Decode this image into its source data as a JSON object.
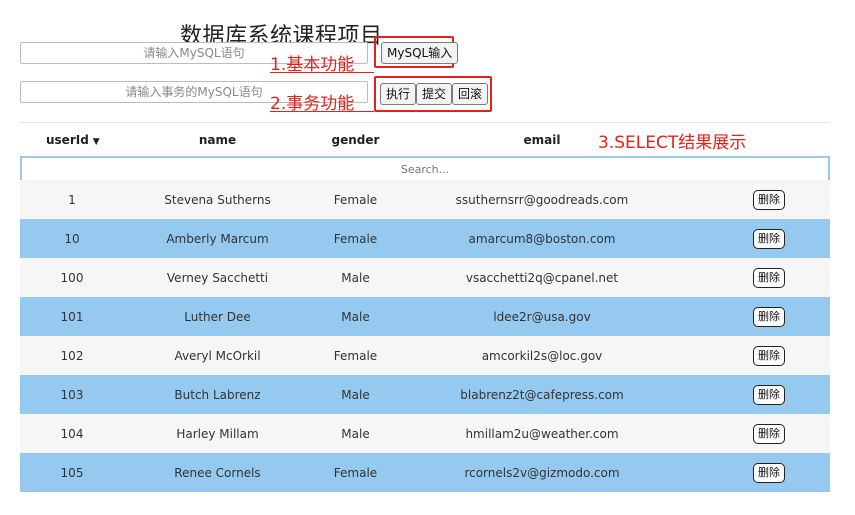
{
  "page": {
    "title": "数据库系统课程项目"
  },
  "sql_input": {
    "placeholder": "请输入MySQL语句"
  },
  "tx_input": {
    "placeholder": "请输入事务的MySQL语句"
  },
  "buttons": {
    "mysql": "MySQL输入",
    "exec": "执行",
    "commit": "提交",
    "rollback": "回滚"
  },
  "annotations": {
    "a1": "1.基本功能",
    "a2": "2.事务功能",
    "a3": "3.SELECT结果展示",
    "color": "#e3221b"
  },
  "table": {
    "columns": [
      "userId",
      "name",
      "gender",
      "email"
    ],
    "sort_icon": "caret-down-icon",
    "search_placeholder": "Search...",
    "delete_label": "删除",
    "rows": [
      {
        "userId": "1",
        "name": "Stevena Sutherns",
        "gender": "Female",
        "email": "ssuthernsrr@goodreads.com"
      },
      {
        "userId": "10",
        "name": "Amberly Marcum",
        "gender": "Female",
        "email": "amarcum8@boston.com"
      },
      {
        "userId": "100",
        "name": "Verney Sacchetti",
        "gender": "Male",
        "email": "vsacchetti2q@cpanel.net"
      },
      {
        "userId": "101",
        "name": "Luther Dee",
        "gender": "Male",
        "email": "ldee2r@usa.gov"
      },
      {
        "userId": "102",
        "name": "Averyl McOrkil",
        "gender": "Female",
        "email": "amcorkil2s@loc.gov"
      },
      {
        "userId": "103",
        "name": "Butch Labrenz",
        "gender": "Male",
        "email": "blabrenz2t@cafepress.com"
      },
      {
        "userId": "104",
        "name": "Harley Millam",
        "gender": "Male",
        "email": "hmillam2u@weather.com"
      },
      {
        "userId": "105",
        "name": "Renee Cornels",
        "gender": "Female",
        "email": "rcornels2v@gizmodo.com"
      }
    ]
  },
  "colors": {
    "row_alt": "#95c9ef",
    "row_base": "#f6f6f6",
    "search_border": "#9ec8e8"
  }
}
